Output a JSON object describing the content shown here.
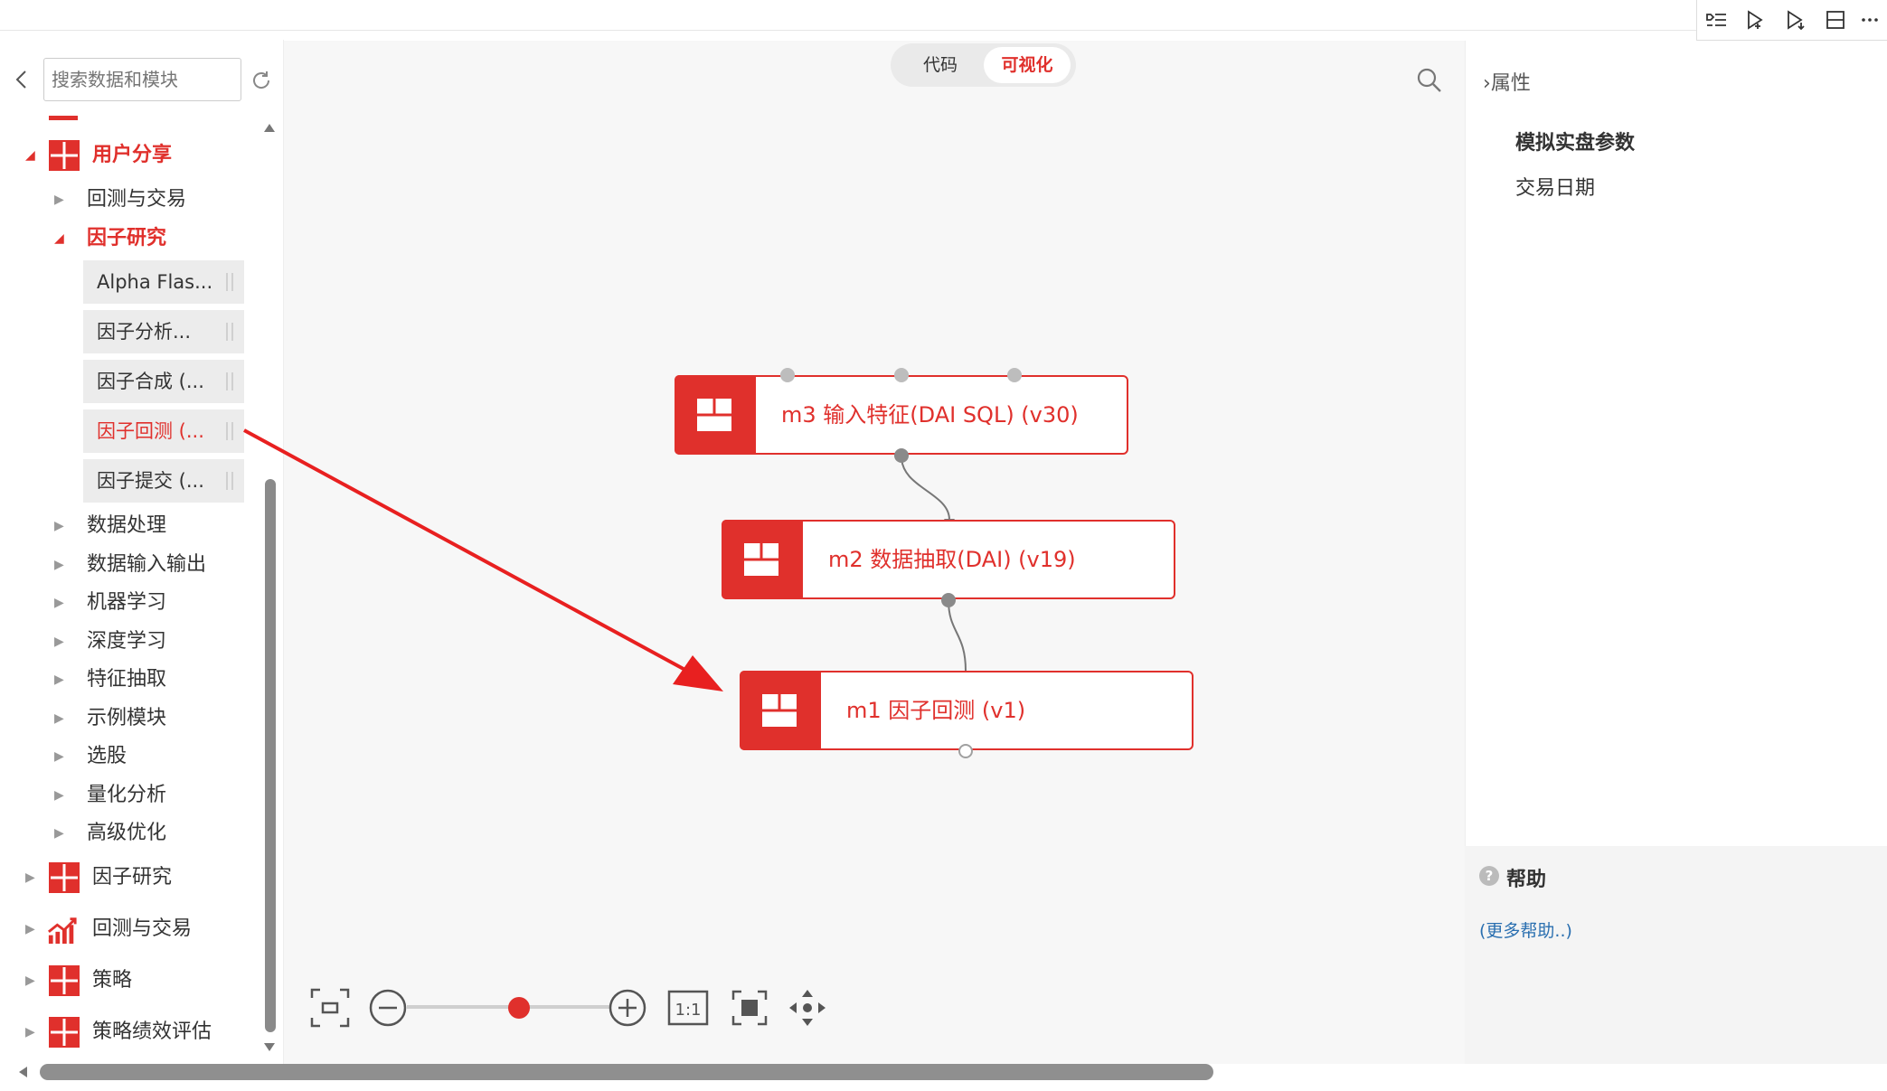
{
  "sidebar": {
    "search_placeholder": "搜索数据和模块",
    "groups": [
      {
        "label": "用户分享"
      },
      {
        "label": "因子研究"
      },
      {
        "label": "回测与交易"
      },
      {
        "label": "策略"
      },
      {
        "label": "策略绩效评估"
      }
    ],
    "sub_items": [
      {
        "label": "回测与交易"
      },
      {
        "label": "因子研究"
      },
      {
        "label": "数据处理"
      },
      {
        "label": "数据输入输出"
      },
      {
        "label": "机器学习"
      },
      {
        "label": "深度学习"
      },
      {
        "label": "特征抽取"
      },
      {
        "label": "示例模块"
      },
      {
        "label": "选股"
      },
      {
        "label": "量化分析"
      },
      {
        "label": "高级优化"
      }
    ],
    "leaves": [
      {
        "label": "Alpha Flas..."
      },
      {
        "label": "因子分析..."
      },
      {
        "label": "因子合成 (..."
      },
      {
        "label": "因子回测 (..."
      },
      {
        "label": "因子提交 (..."
      }
    ]
  },
  "canvas": {
    "mode_code": "代码",
    "mode_visual": "可视化",
    "nodes": [
      {
        "label": "m3 输入特征(DAI SQL) (v30)"
      },
      {
        "label": "m2 数据抽取(DAI) (v19)"
      },
      {
        "label": "m1 因子回测 (v1)"
      }
    ],
    "zoom_level": 0.55
  },
  "properties": {
    "title": "属性",
    "section": "模拟实盘参数",
    "item": "交易日期"
  },
  "help": {
    "title": "帮助",
    "link": "(更多帮助..)"
  },
  "colors": {
    "accent": "#e0302c",
    "canvas_bg": "#f7f7f7"
  }
}
